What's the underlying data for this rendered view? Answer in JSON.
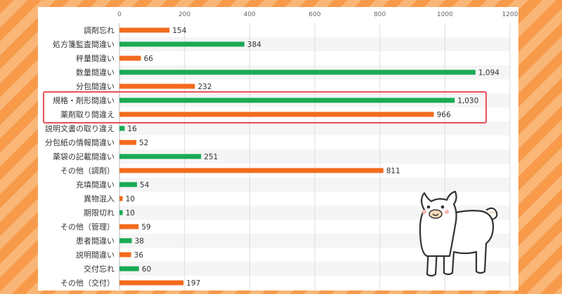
{
  "colors": {
    "orange": "#f26b1d",
    "green": "#1aaa55",
    "highlight": "#e8505b",
    "grid": "#dddddd"
  },
  "chart_data": {
    "type": "bar",
    "orientation": "horizontal",
    "xlim": [
      0,
      1200
    ],
    "ticks": [
      "0",
      "200",
      "400",
      "600",
      "800",
      "1000",
      "1200"
    ],
    "categories": [
      "調剤忘れ",
      "処方箋監査間違い",
      "秤量間違い",
      "数量間違い",
      "分包間違い",
      "規格・剤形間違い",
      "薬剤取り間違え",
      "説明文書の取り違え",
      "分包紙の情報間違い",
      "薬袋の記載間違い",
      "その他（調剤）",
      "充填間違い",
      "異物混入",
      "期限切れ",
      "その他（管理）",
      "患者間違い",
      "説明間違い",
      "交付忘れ",
      "その他（交付）"
    ],
    "values": [
      154,
      384,
      66,
      1094,
      232,
      1030,
      966,
      16,
      52,
      251,
      811,
      54,
      10,
      10,
      59,
      38,
      36,
      60,
      197
    ],
    "value_labels": [
      "154",
      "384",
      "66",
      "1,094",
      "232",
      "1,030",
      "966",
      "16",
      "52",
      "251",
      "811",
      "54",
      "10",
      "10",
      "59",
      "38",
      "36",
      "60",
      "197"
    ],
    "bar_colors": [
      "orange",
      "green",
      "orange",
      "green",
      "orange",
      "green",
      "orange",
      "green",
      "orange",
      "green",
      "orange",
      "green",
      "orange",
      "green",
      "orange",
      "green",
      "orange",
      "green",
      "orange"
    ],
    "highlighted": [
      "規格・剤形間違い",
      "薬剤取り間違え"
    ],
    "grid": true
  }
}
